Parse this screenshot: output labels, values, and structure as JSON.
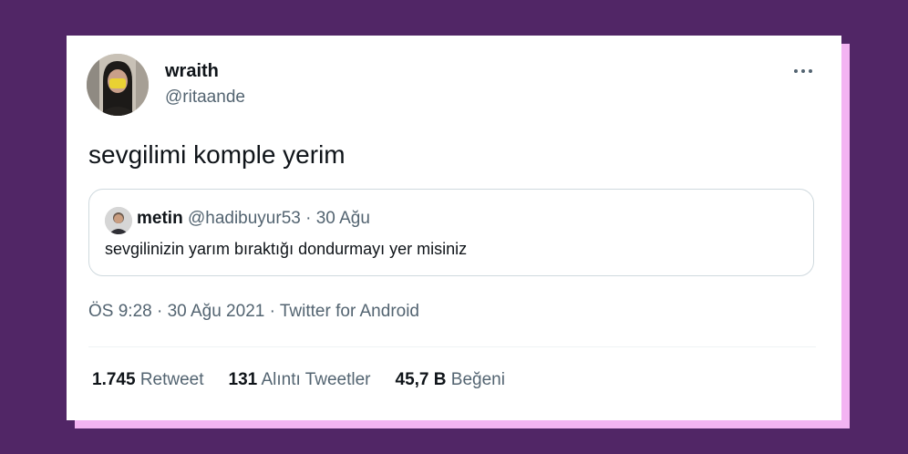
{
  "tweet": {
    "author": {
      "name": "wraith",
      "handle": "@ritaande"
    },
    "more_icon": "more-horizontal-icon",
    "text": "sevgilimi komple yerim",
    "quoted": {
      "name": "metin",
      "handle": "@hadibuyur53",
      "sep": "·",
      "date": "30 Ağu",
      "text": "sevgilinizin yarım bıraktığı dondurmayı yer misiniz"
    },
    "meta": {
      "time": "ÖS 9:28",
      "sep1": "·",
      "date": "30 Ağu 2021",
      "sep2": "·",
      "source": "Twitter for Android"
    },
    "stats": {
      "retweets": {
        "count": "1.745",
        "label": "Retweet"
      },
      "quotes": {
        "count": "131",
        "label": "Alıntı Tweetler"
      },
      "likes": {
        "count": "45,7 B",
        "label": "Beğeni"
      }
    }
  },
  "colors": {
    "background": "#512666",
    "card_shadow": "#f3b4f2",
    "card": "#ffffff",
    "text_primary": "#0f1419",
    "text_secondary": "#536471",
    "border": "#cfd9de"
  }
}
